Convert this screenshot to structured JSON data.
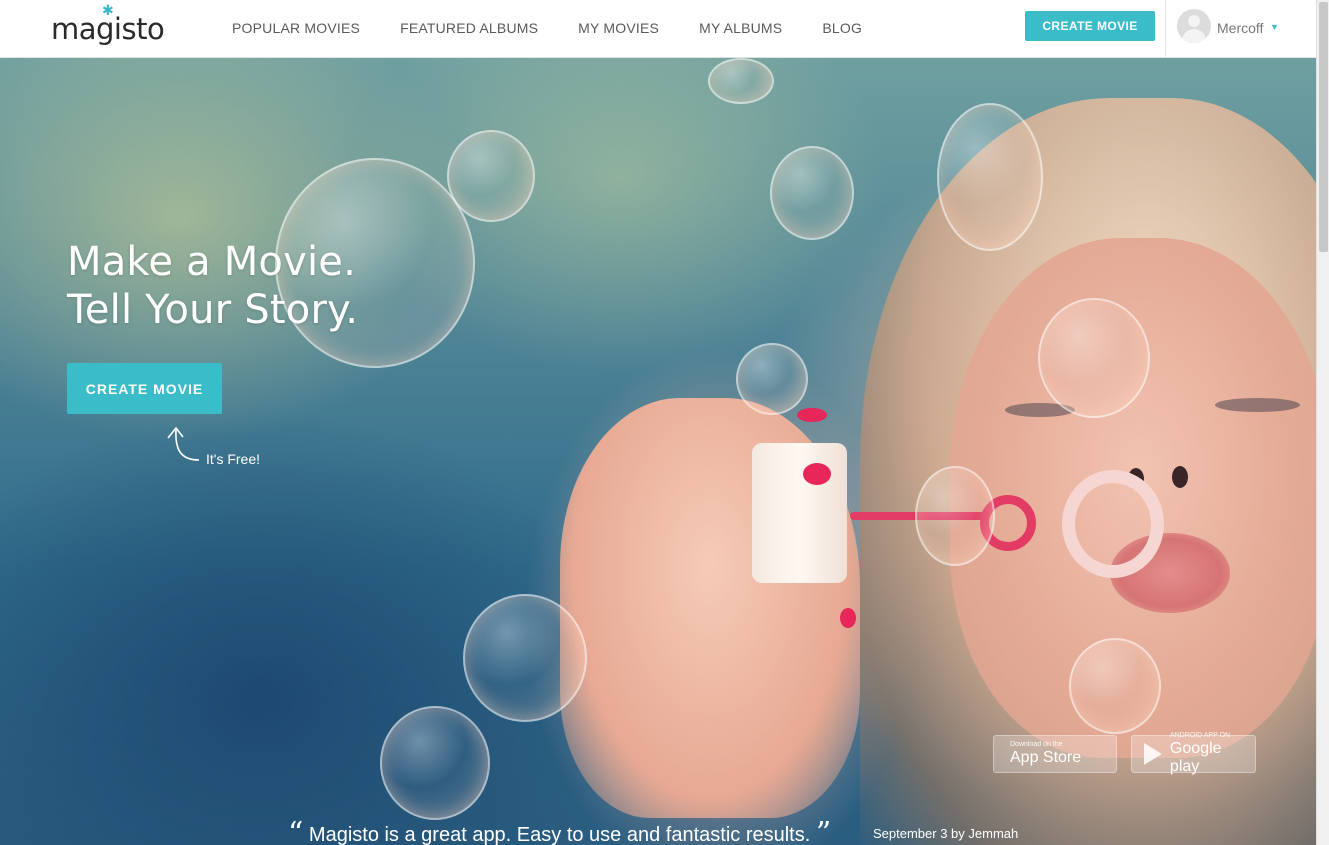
{
  "header": {
    "logo_text": "magisto",
    "nav": [
      "POPULAR MOVIES",
      "FEATURED ALBUMS",
      "MY MOVIES",
      "MY ALBUMS",
      "BLOG"
    ],
    "create_button": "CREATE MOVIE",
    "user": {
      "name": "Mercoff",
      "avatar_icon": "default-avatar-icon"
    }
  },
  "hero": {
    "headline_line1": "Make a Movie.",
    "headline_line2": "Tell Your Story.",
    "cta_button": "CREATE MOVIE",
    "cta_note": "It's Free!",
    "app_store": {
      "small": "Download on the",
      "big": "App Store",
      "icon": "apple-icon"
    },
    "google_play": {
      "small": "ANDROID APP ON",
      "big": "Google play",
      "icon": "google-play-icon"
    },
    "testimonial": {
      "open_quote": "“",
      "text": "Magisto is a great app. Easy to use and fantastic results.",
      "close_quote": "”",
      "meta": "September 3 by Jemmah"
    }
  },
  "colors": {
    "accent": "#3bbcc9",
    "nav_text": "#5a5a5a"
  }
}
